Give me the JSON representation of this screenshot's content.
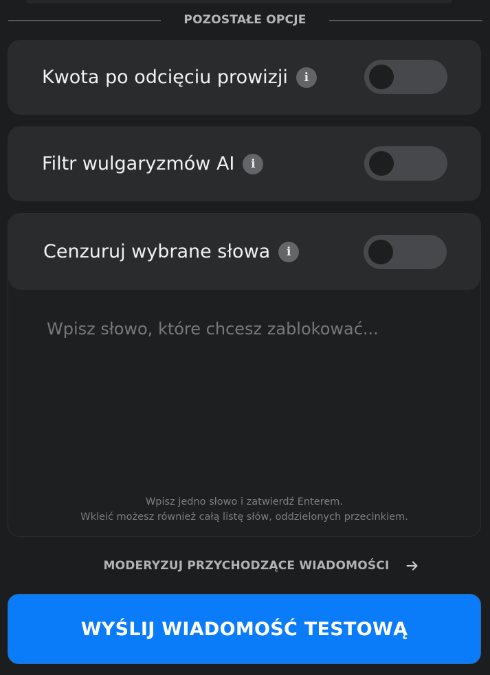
{
  "section": {
    "title": "POZOSTAŁE OPCJE"
  },
  "options": [
    {
      "label": "Kwota po odcięciu prowizji",
      "info_icon": "info-icon",
      "enabled": false
    },
    {
      "label": "Filtr wulgaryzmów AI",
      "info_icon": "info-icon",
      "enabled": false
    },
    {
      "label": "Cenzuruj wybrane słowa",
      "info_icon": "info-icon",
      "enabled": false
    }
  ],
  "censor": {
    "placeholder": "Wpisz słowo, które chcesz zablokować...",
    "hint_line1": "Wpisz jedno słowo i zatwierdź Enterem.",
    "hint_line2": "Wkleić możesz również całą listę słów, oddzielonych przecinkiem."
  },
  "moderate_link": {
    "label": "MODERYZUJ PRZYCHODZĄCE WIADOMOŚCI",
    "icon": "arrow-right-icon"
  },
  "send_button": {
    "label": "WYŚLIJ WIADOMOŚĆ TESTOWĄ"
  },
  "colors": {
    "background": "#1c1d1f",
    "card": "#2a2b2d",
    "toggle_off": "#46484b",
    "accent": "#0a7cf9"
  }
}
